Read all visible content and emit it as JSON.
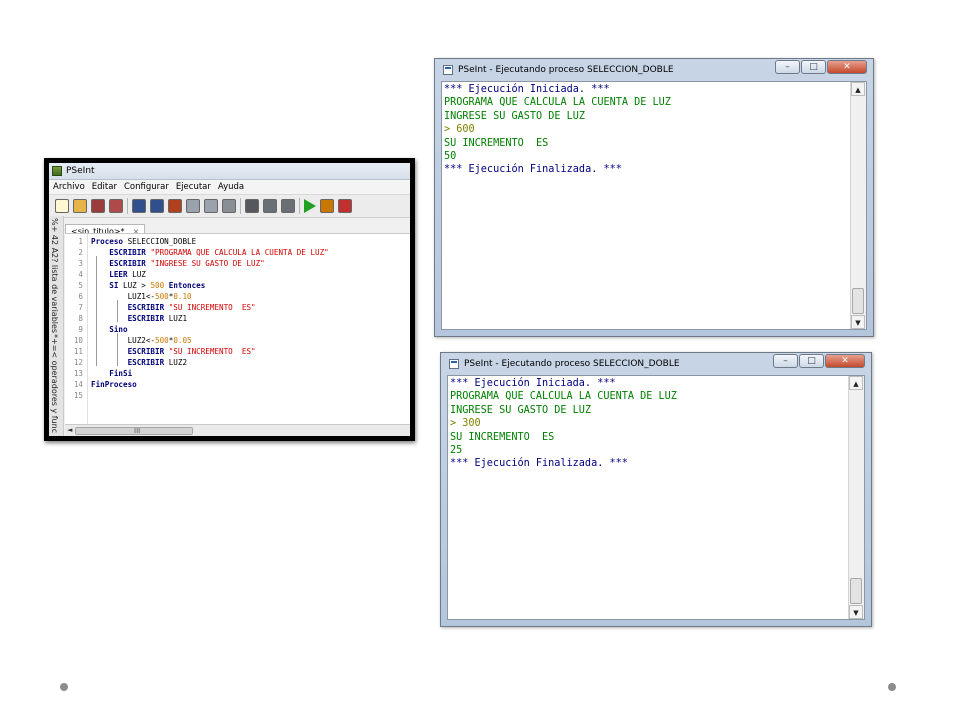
{
  "editor": {
    "title": "PSeInt",
    "menu": [
      "Archivo",
      "Editar",
      "Configurar",
      "Ejecutar",
      "Ayuda"
    ],
    "toolbar_icons": [
      "new-file-icon",
      "open-folder-icon",
      "save-icon",
      "save-as-icon",
      "undo-icon",
      "redo-icon",
      "cut-icon",
      "copy-icon",
      "paste-icon",
      "edit-icon",
      "find-icon",
      "replace-icon",
      "find-next-icon",
      "run-icon",
      "step-icon",
      "close-icon"
    ],
    "side_panel_top": "%+ 42 A2? lista de variables",
    "side_panel_bottom": "*+=< operadores y func",
    "tab_label": "<sin_titulo>*",
    "tab_close": "×",
    "scroll_grip": "III",
    "lines": [
      {
        "n": "1",
        "parts": [
          {
            "t": "Proceso ",
            "c": "kw"
          },
          {
            "t": "SELECCION_DOBLE",
            "c": "id"
          }
        ]
      },
      {
        "n": "2",
        "parts": [
          {
            "t": "    ESCRIBIR ",
            "c": "kw"
          },
          {
            "t": "\"PROGRAMA QUE CALCULA LA CUENTA DE LUZ\"",
            "c": "str"
          }
        ]
      },
      {
        "n": "3",
        "parts": [
          {
            "t": "    ESCRIBIR ",
            "c": "kw"
          },
          {
            "t": "\"INGRESE SU GASTO DE LUZ\"",
            "c": "str"
          }
        ]
      },
      {
        "n": "4",
        "parts": [
          {
            "t": "    LEER ",
            "c": "kw"
          },
          {
            "t": "LUZ",
            "c": "id"
          }
        ]
      },
      {
        "n": "5",
        "parts": [
          {
            "t": "    SI ",
            "c": "kw"
          },
          {
            "t": "LUZ > ",
            "c": "id"
          },
          {
            "t": "500",
            "c": "num"
          },
          {
            "t": " Entonces",
            "c": "kw"
          }
        ]
      },
      {
        "n": "6",
        "parts": [
          {
            "t": "        LUZ1<-",
            "c": "id"
          },
          {
            "t": "500",
            "c": "num"
          },
          {
            "t": "*",
            "c": "op"
          },
          {
            "t": "0.10",
            "c": "num"
          }
        ]
      },
      {
        "n": "7",
        "parts": [
          {
            "t": "        ESCRIBIR ",
            "c": "kw"
          },
          {
            "t": "\"SU INCREMENTO  ES\"",
            "c": "str"
          }
        ]
      },
      {
        "n": "8",
        "parts": [
          {
            "t": "        ESCRIBIR ",
            "c": "kw"
          },
          {
            "t": "LUZ1",
            "c": "id"
          }
        ]
      },
      {
        "n": "9",
        "parts": [
          {
            "t": "    Sino",
            "c": "kw"
          }
        ]
      },
      {
        "n": "10",
        "parts": [
          {
            "t": "        LUZ2<-",
            "c": "id"
          },
          {
            "t": "500",
            "c": "num"
          },
          {
            "t": "*",
            "c": "op"
          },
          {
            "t": "0.05",
            "c": "num"
          }
        ]
      },
      {
        "n": "11",
        "parts": [
          {
            "t": "        ESCRIBIR ",
            "c": "kw"
          },
          {
            "t": "\"SU INCREMENTO  ES\"",
            "c": "str"
          }
        ]
      },
      {
        "n": "12",
        "parts": [
          {
            "t": "        ESCRIBIR ",
            "c": "kw"
          },
          {
            "t": "LUZ2",
            "c": "id"
          }
        ]
      },
      {
        "n": "13",
        "parts": [
          {
            "t": "    FinSi",
            "c": "kw"
          }
        ]
      },
      {
        "n": "14",
        "parts": [
          {
            "t": "FinProceso",
            "c": "kw"
          }
        ]
      },
      {
        "n": "15",
        "parts": []
      }
    ]
  },
  "consoles": [
    {
      "title": "PSeInt - Ejecutando proceso SELECCION_DOBLE",
      "lines": [
        {
          "t": "*** Ejecución Iniciada. ***",
          "c": "blue"
        },
        {
          "t": "PROGRAMA QUE CALCULA LA CUENTA DE LUZ",
          "c": "green"
        },
        {
          "t": "INGRESE SU GASTO DE LUZ",
          "c": "green"
        },
        {
          "t": "> 600",
          "c": "olive"
        },
        {
          "t": "SU INCREMENTO  ES",
          "c": "green"
        },
        {
          "t": "50",
          "c": "green"
        },
        {
          "t": "*** Ejecución Finalizada. ***",
          "c": "blue"
        }
      ]
    },
    {
      "title": "PSeInt - Ejecutando proceso SELECCION_DOBLE",
      "lines": [
        {
          "t": "*** Ejecución Iniciada. ***",
          "c": "blue"
        },
        {
          "t": "PROGRAMA QUE CALCULA LA CUENTA DE LUZ",
          "c": "green"
        },
        {
          "t": "INGRESE SU GASTO DE LUZ",
          "c": "green"
        },
        {
          "t": "> 300",
          "c": "olive"
        },
        {
          "t": "SU INCREMENTO  ES",
          "c": "green"
        },
        {
          "t": "25",
          "c": "green"
        },
        {
          "t": "*** Ejecución Finalizada. ***",
          "c": "blue"
        }
      ]
    }
  ],
  "window_buttons": {
    "minimize": "–",
    "maximize": "□",
    "close": "✕"
  },
  "scroll_arrows": {
    "up": "▲",
    "down": "▼",
    "left": "◄"
  }
}
